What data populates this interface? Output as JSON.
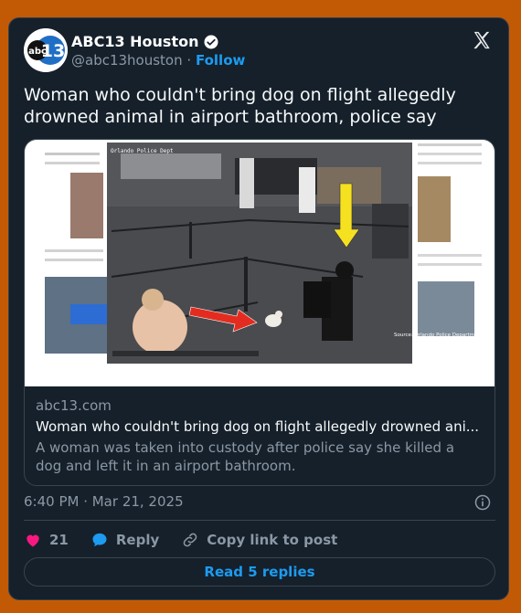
{
  "author": {
    "name": "ABC13 Houston",
    "handle": "@abc13houston",
    "separator": "·",
    "follow_label": "Follow",
    "avatar_logo": {
      "abc": "abc",
      "number": "13"
    }
  },
  "tweet": {
    "text": "Woman who couldn't bring dog on flight allegedly drowned animal in airport bathroom, police say"
  },
  "link_card": {
    "domain": "abc13.com",
    "title": "Woman who couldn't bring dog on flight allegedly drowned ani...",
    "description": "A woman was taken into custody after police say she killed a dog and left it in an airport bathroom.",
    "image": {
      "overlay_top": "Orlando Police Dept",
      "source_caption": "Source: Orlando Police Department"
    }
  },
  "meta": {
    "timestamp": "6:40 PM · Mar 21, 2025"
  },
  "actions": {
    "likes_count": "21",
    "reply_label": "Reply",
    "copy_label": "Copy link to post"
  },
  "read_replies_label": "Read 5 replies",
  "colors": {
    "page_background": "#c25a05",
    "card_background": "#15202b",
    "accent": "#1d9bf0",
    "like": "#f91880",
    "verified": "#ffffff"
  },
  "icons": [
    "verified-badge-icon",
    "x-logo-icon",
    "info-icon",
    "heart-icon",
    "reply-bubble-icon",
    "link-icon"
  ]
}
